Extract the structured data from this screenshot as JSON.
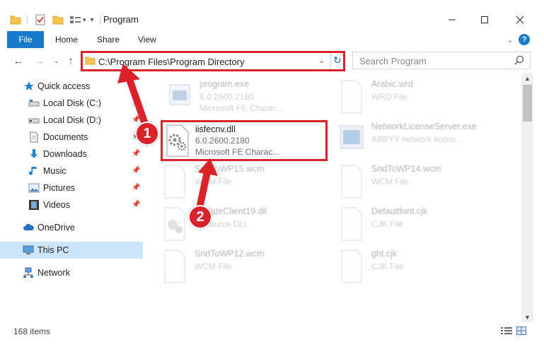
{
  "window": {
    "title": "Program",
    "minimize_icon": "minimize-icon",
    "maximize_icon": "maximize-icon",
    "close_icon": "close-icon"
  },
  "ribbon": {
    "tabs": [
      "File",
      "Home",
      "Share",
      "View"
    ]
  },
  "address_bar": {
    "path": "C:\\Program Files\\Program Directory"
  },
  "search": {
    "placeholder": "Search Program"
  },
  "sidebar": {
    "items": [
      {
        "label": "Quick access",
        "icon": "star-icon"
      },
      {
        "label": "Local Disk (C:)",
        "icon": "drive-icon"
      },
      {
        "label": "Local Disk (D:)",
        "icon": "drive-icon"
      },
      {
        "label": "Documents",
        "icon": "document-icon"
      },
      {
        "label": "Downloads",
        "icon": "download-icon"
      },
      {
        "label": "Music",
        "icon": "music-icon"
      },
      {
        "label": "Pictures",
        "icon": "picture-icon"
      },
      {
        "label": "Videos",
        "icon": "video-icon"
      },
      {
        "label": "OneDrive",
        "icon": "cloud-icon"
      },
      {
        "label": "This PC",
        "icon": "computer-icon"
      },
      {
        "label": "Network",
        "icon": "network-icon"
      }
    ]
  },
  "files": [
    {
      "name": "program.exe",
      "line2": "6.0.2600.2180",
      "line3": "Microsoft FE Charac...",
      "icon": "exe-icon"
    },
    {
      "name": "Arabic.wrd",
      "line2": "WRD File",
      "line3": "",
      "icon": "file-icon"
    },
    {
      "name": "iisfecnv.dll",
      "line2": "6.0.2600.2180",
      "line3": "Microsoft FE Charac...",
      "icon": "dll-gear-icon"
    },
    {
      "name": "NetworkLicenseServer.exe",
      "line2": "ABBYY network licens...",
      "line3": "",
      "icon": "exe-icon"
    },
    {
      "name": "SndToWP15.wcm",
      "line2": "WCM File",
      "line3": "",
      "icon": "file-icon"
    },
    {
      "name": "SndToWP14.wcm",
      "line2": "WCM File",
      "line3": "",
      "icon": "file-icon"
    },
    {
      "name": "UpdateClient19.dll",
      "line2": "Resource DLL",
      "line3": "",
      "icon": "dll-gear-icon"
    },
    {
      "name": "Defaultfont.cjk",
      "line2": "CJK File",
      "line3": "",
      "icon": "file-icon"
    },
    {
      "name": "SndToWP12.wcm",
      "line2": "WCM File",
      "line3": "",
      "icon": "file-icon"
    },
    {
      "name": "ght.cjk",
      "line2": "CJK File",
      "line3": "",
      "icon": "file-icon"
    }
  ],
  "status": {
    "item_count": "168 items"
  },
  "callouts": [
    "1",
    "2"
  ],
  "colors": {
    "accent": "#1979ca",
    "highlight": "#d9222a",
    "selected": "#cce4f7"
  }
}
